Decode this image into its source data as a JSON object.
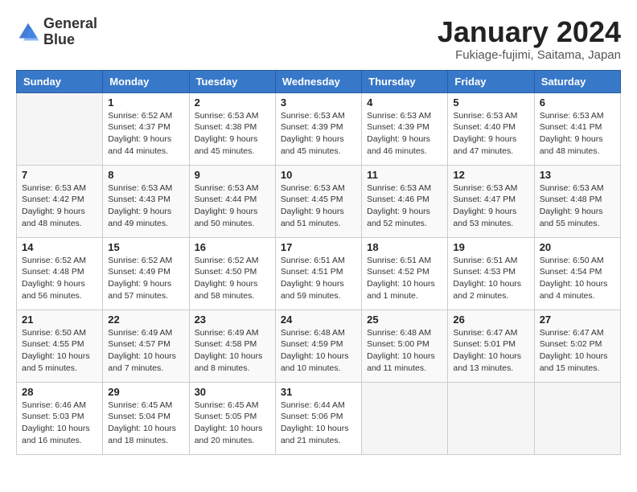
{
  "logo": {
    "line1": "General",
    "line2": "Blue"
  },
  "title": "January 2024",
  "location": "Fukiage-fujimi, Saitama, Japan",
  "days_of_week": [
    "Sunday",
    "Monday",
    "Tuesday",
    "Wednesday",
    "Thursday",
    "Friday",
    "Saturday"
  ],
  "weeks": [
    [
      {
        "day": "",
        "info": ""
      },
      {
        "day": "1",
        "info": "Sunrise: 6:52 AM\nSunset: 4:37 PM\nDaylight: 9 hours\nand 44 minutes."
      },
      {
        "day": "2",
        "info": "Sunrise: 6:53 AM\nSunset: 4:38 PM\nDaylight: 9 hours\nand 45 minutes."
      },
      {
        "day": "3",
        "info": "Sunrise: 6:53 AM\nSunset: 4:39 PM\nDaylight: 9 hours\nand 45 minutes."
      },
      {
        "day": "4",
        "info": "Sunrise: 6:53 AM\nSunset: 4:39 PM\nDaylight: 9 hours\nand 46 minutes."
      },
      {
        "day": "5",
        "info": "Sunrise: 6:53 AM\nSunset: 4:40 PM\nDaylight: 9 hours\nand 47 minutes."
      },
      {
        "day": "6",
        "info": "Sunrise: 6:53 AM\nSunset: 4:41 PM\nDaylight: 9 hours\nand 48 minutes."
      }
    ],
    [
      {
        "day": "7",
        "info": "Sunrise: 6:53 AM\nSunset: 4:42 PM\nDaylight: 9 hours\nand 48 minutes."
      },
      {
        "day": "8",
        "info": "Sunrise: 6:53 AM\nSunset: 4:43 PM\nDaylight: 9 hours\nand 49 minutes."
      },
      {
        "day": "9",
        "info": "Sunrise: 6:53 AM\nSunset: 4:44 PM\nDaylight: 9 hours\nand 50 minutes."
      },
      {
        "day": "10",
        "info": "Sunrise: 6:53 AM\nSunset: 4:45 PM\nDaylight: 9 hours\nand 51 minutes."
      },
      {
        "day": "11",
        "info": "Sunrise: 6:53 AM\nSunset: 4:46 PM\nDaylight: 9 hours\nand 52 minutes."
      },
      {
        "day": "12",
        "info": "Sunrise: 6:53 AM\nSunset: 4:47 PM\nDaylight: 9 hours\nand 53 minutes."
      },
      {
        "day": "13",
        "info": "Sunrise: 6:53 AM\nSunset: 4:48 PM\nDaylight: 9 hours\nand 55 minutes."
      }
    ],
    [
      {
        "day": "14",
        "info": "Sunrise: 6:52 AM\nSunset: 4:48 PM\nDaylight: 9 hours\nand 56 minutes."
      },
      {
        "day": "15",
        "info": "Sunrise: 6:52 AM\nSunset: 4:49 PM\nDaylight: 9 hours\nand 57 minutes."
      },
      {
        "day": "16",
        "info": "Sunrise: 6:52 AM\nSunset: 4:50 PM\nDaylight: 9 hours\nand 58 minutes."
      },
      {
        "day": "17",
        "info": "Sunrise: 6:51 AM\nSunset: 4:51 PM\nDaylight: 9 hours\nand 59 minutes."
      },
      {
        "day": "18",
        "info": "Sunrise: 6:51 AM\nSunset: 4:52 PM\nDaylight: 10 hours\nand 1 minute."
      },
      {
        "day": "19",
        "info": "Sunrise: 6:51 AM\nSunset: 4:53 PM\nDaylight: 10 hours\nand 2 minutes."
      },
      {
        "day": "20",
        "info": "Sunrise: 6:50 AM\nSunset: 4:54 PM\nDaylight: 10 hours\nand 4 minutes."
      }
    ],
    [
      {
        "day": "21",
        "info": "Sunrise: 6:50 AM\nSunset: 4:55 PM\nDaylight: 10 hours\nand 5 minutes."
      },
      {
        "day": "22",
        "info": "Sunrise: 6:49 AM\nSunset: 4:57 PM\nDaylight: 10 hours\nand 7 minutes."
      },
      {
        "day": "23",
        "info": "Sunrise: 6:49 AM\nSunset: 4:58 PM\nDaylight: 10 hours\nand 8 minutes."
      },
      {
        "day": "24",
        "info": "Sunrise: 6:48 AM\nSunset: 4:59 PM\nDaylight: 10 hours\nand 10 minutes."
      },
      {
        "day": "25",
        "info": "Sunrise: 6:48 AM\nSunset: 5:00 PM\nDaylight: 10 hours\nand 11 minutes."
      },
      {
        "day": "26",
        "info": "Sunrise: 6:47 AM\nSunset: 5:01 PM\nDaylight: 10 hours\nand 13 minutes."
      },
      {
        "day": "27",
        "info": "Sunrise: 6:47 AM\nSunset: 5:02 PM\nDaylight: 10 hours\nand 15 minutes."
      }
    ],
    [
      {
        "day": "28",
        "info": "Sunrise: 6:46 AM\nSunset: 5:03 PM\nDaylight: 10 hours\nand 16 minutes."
      },
      {
        "day": "29",
        "info": "Sunrise: 6:45 AM\nSunset: 5:04 PM\nDaylight: 10 hours\nand 18 minutes."
      },
      {
        "day": "30",
        "info": "Sunrise: 6:45 AM\nSunset: 5:05 PM\nDaylight: 10 hours\nand 20 minutes."
      },
      {
        "day": "31",
        "info": "Sunrise: 6:44 AM\nSunset: 5:06 PM\nDaylight: 10 hours\nand 21 minutes."
      },
      {
        "day": "",
        "info": ""
      },
      {
        "day": "",
        "info": ""
      },
      {
        "day": "",
        "info": ""
      }
    ]
  ]
}
